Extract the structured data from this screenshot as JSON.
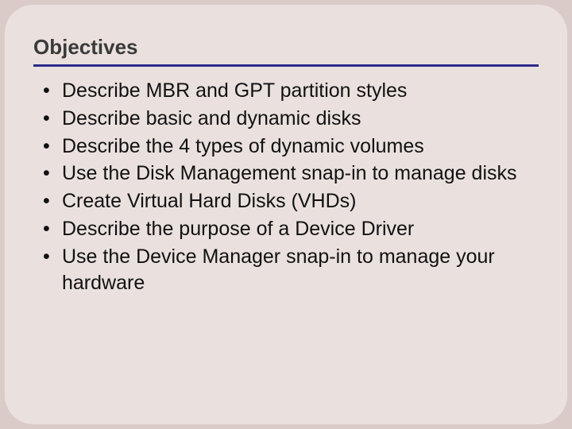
{
  "title": "Objectives",
  "items": [
    "Describe MBR and GPT partition styles",
    "Describe basic and dynamic disks",
    "Describe the 4 types of dynamic volumes",
    "Use the Disk Management snap-in to manage disks",
    "Create Virtual Hard Disks (VHDs)",
    "Describe the purpose of a Device Driver",
    "Use the Device Manager snap-in to manage your hardware"
  ]
}
